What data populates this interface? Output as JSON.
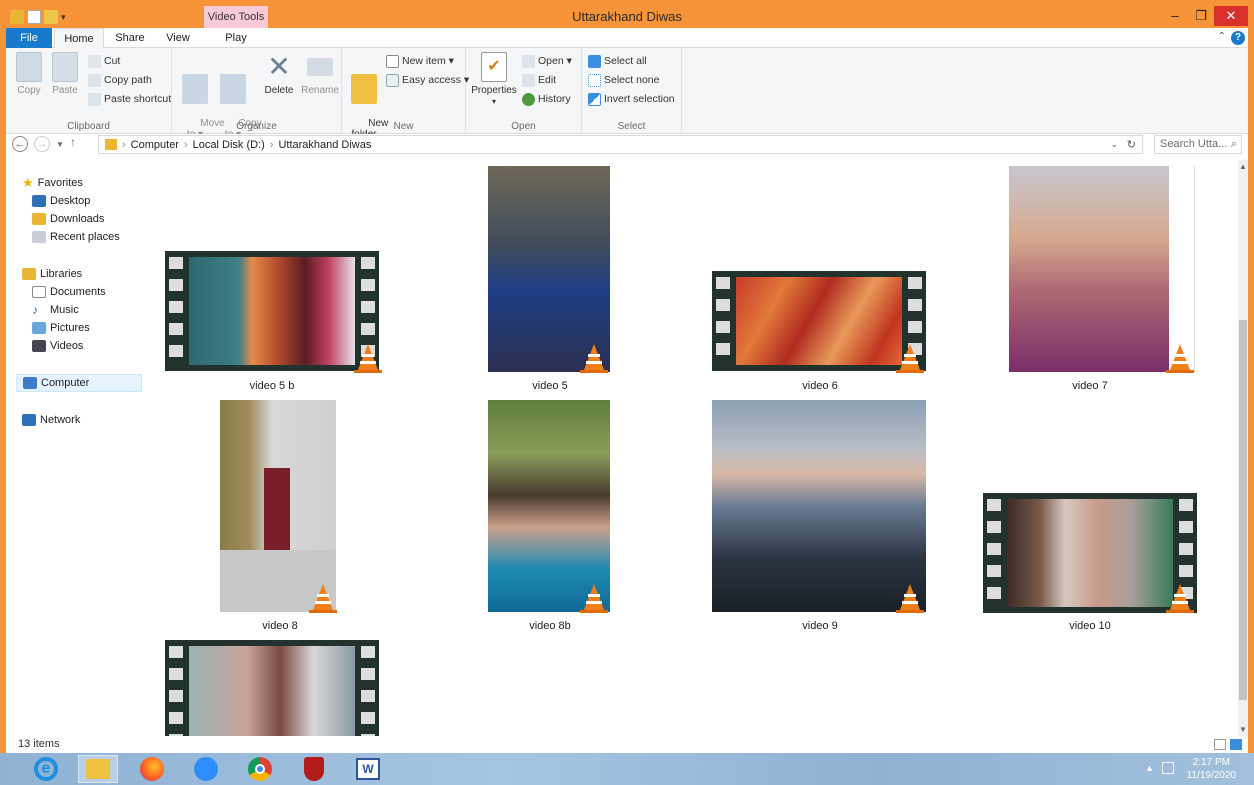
{
  "window": {
    "title": "Uttarakhand Diwas",
    "context_tab": "Video Tools"
  },
  "tabs": [
    "File",
    "Home",
    "Share",
    "View",
    "Play"
  ],
  "ribbon": {
    "clipboard": {
      "copy": "Copy",
      "paste": "Paste",
      "cut": "Cut",
      "copy_path": "Copy path",
      "paste_shortcut": "Paste shortcut",
      "label": "Clipboard"
    },
    "organize": {
      "move_to": "Move\nto ▾",
      "copy_to": "Copy\nto ▾",
      "delete": "Delete",
      "rename": "Rename",
      "label": "Organize"
    },
    "new": {
      "new_folder": "New\nfolder",
      "new_item": "New item ▾",
      "easy_access": "Easy access ▾",
      "label": "New"
    },
    "open": {
      "properties": "Properties",
      "open": "Open ▾",
      "edit": "Edit",
      "history": "History",
      "label": "Open"
    },
    "select": {
      "select_all": "Select all",
      "select_none": "Select none",
      "invert": "Invert selection",
      "label": "Select"
    }
  },
  "address": {
    "crumbs": [
      "Computer",
      "Local Disk (D:)",
      "Uttarakhand Diwas"
    ],
    "search_placeholder": "Search Utta..."
  },
  "sidebar": {
    "favorites": "Favorites",
    "desktop": "Desktop",
    "downloads": "Downloads",
    "recent": "Recent places",
    "libraries": "Libraries",
    "documents": "Documents",
    "music": "Music",
    "pictures": "Pictures",
    "videos": "Videos",
    "computer": "Computer",
    "network": "Network"
  },
  "files": [
    "video 5 b",
    "video 5",
    "video 6",
    "video 7",
    "video 8",
    "video 8b",
    "video 9",
    "video 10"
  ],
  "status": {
    "items": "13 items"
  },
  "clock": {
    "time": "2:17 PM",
    "date": "11/19/2020"
  },
  "colors": {
    "accent": "#1979ca",
    "titlebar": "#f7943a",
    "close": "#d9302c"
  }
}
